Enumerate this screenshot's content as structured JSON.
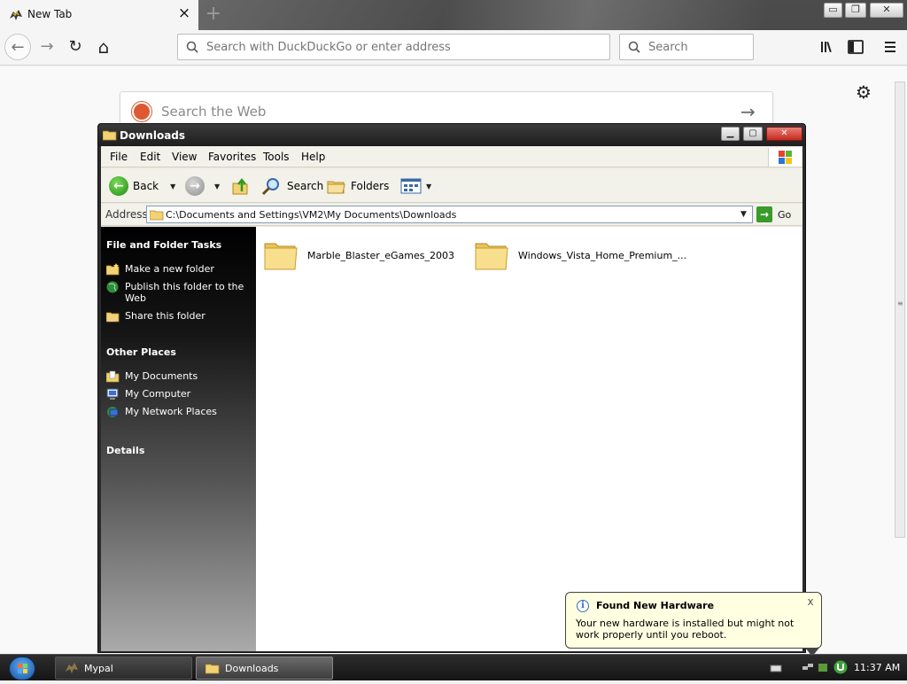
{
  "browser": {
    "tab_title": "New Tab",
    "tab_close": "×",
    "new_tab": "+",
    "window_controls": {
      "minimize": "▭",
      "maximize": "❐",
      "close": "✕"
    },
    "nav": {
      "back": "←",
      "forward": "→",
      "reload": "↻",
      "home": "⌂"
    },
    "url_placeholder": "Search with DuckDuckGo or enter address",
    "search_placeholder": "Search",
    "toolbar_icons": [
      "library-icon",
      "sidebar-icon",
      "menu-icon"
    ]
  },
  "page": {
    "search_placeholder": "Search the Web",
    "submit_arrow": "→",
    "settings_icon": "⚙"
  },
  "explorer": {
    "title": "Downloads",
    "menus": [
      "File",
      "Edit",
      "View",
      "Favorites",
      "Tools",
      "Help"
    ],
    "toolbar": {
      "back": "Back",
      "search": "Search",
      "folders": "Folders"
    },
    "address_label": "Address",
    "address_path": "C:\\Documents and Settings\\VM2\\My Documents\\Downloads",
    "go_label": "Go",
    "tasks": {
      "file_folder_heading": "File and Folder Tasks",
      "file_folder_items": [
        "Make a new folder",
        "Publish this folder to the Web",
        "Share this folder"
      ],
      "other_places_heading": "Other Places",
      "other_places_items": [
        "My Documents",
        "My Computer",
        "My Network Places"
      ],
      "details_heading": "Details"
    },
    "files": [
      "Marble_Blaster_eGames_2003",
      "Windows_Vista_Home_Premium_..."
    ]
  },
  "notification": {
    "title": "Found New Hardware",
    "text": "Your new hardware is installed but might not work properly until you reboot.",
    "close": "x"
  },
  "taskbar": {
    "tasks": [
      "Mypal",
      "Downloads"
    ],
    "clock": "11:37 AM"
  }
}
